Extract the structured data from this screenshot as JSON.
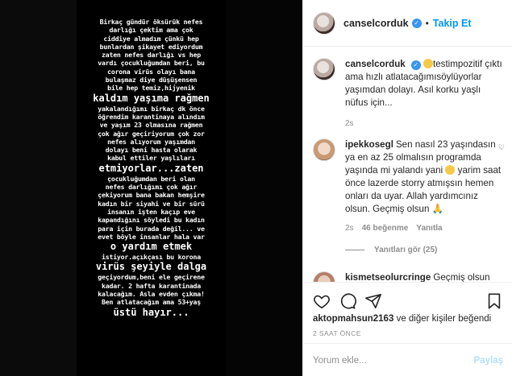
{
  "story": {
    "lines": [
      "Birkaç gündür öksürük nefes",
      "darlığı çektim ama çok",
      "ciddiye almadım çünkü hep",
      "bunlardan şikayet ediyordum",
      "zaten nefes darlığı vs hep",
      "vardı çocukluğumdan beri, bu",
      "corona virüs olayı bana",
      "bulaşmaz diye düşüşensen",
      "bile hep temiz,hijyenik",
      "kaldım yaşıma rağmen",
      "yakalandığımı birkaç dk önce",
      "öğrendim karantinaya alındım",
      "ve yaşım 23 olmasına rağmen",
      "çok ağır geçiriyorum çok zor",
      "nefes alıyorum yaşımdan",
      "dolayı beni hasta olarak",
      "kabul ettiler yaşlıları",
      "etmiyorlar...zaten",
      "çocukluğumdan beri olan",
      "nefes darlığımı çok ağır",
      "çekiyorum bana bakan hemşire",
      "kadın bir siyahi ve bir sürü",
      "insanın işten kaçıp eve",
      "kapandığını söyledi bu kadın",
      "para için burada değil... ve",
      "evet böyle insanlar hala var",
      "o yardım etmek",
      "istiyor.açıkçası bu korona",
      "virüs şeyiyle dalga",
      "geçiyordum,beni ele geçirene",
      "kadar. 2 hafta karantinada",
      "kalacağım. Asla evden çıkma!",
      "Ben atlatacağım ama 53+yaş",
      "üstü hayır..."
    ]
  },
  "header": {
    "username": "canselcorduk",
    "follow_label": "Takip Et",
    "dot": "•"
  },
  "caption": {
    "username": "canselcorduk",
    "text": "testimpozitif çıktı ama hızlı atlatacağımısöylüyorlar yaşımdan dolayı. Asıl korku yaşlı nüfus için...",
    "time": "2s"
  },
  "comment1": {
    "username": "ipekkosegl",
    "text_a": "Sen nasıl 23 yaşındasın ya en az 25 olmalısın programda yaşında mi yalandı yani",
    "text_b": "yarim saat önce lazerde storry atmışsın hemen onları da uyar. Allah yardımcınız olsun. Geçmiş olsun",
    "time": "2s",
    "likes": "46 beğenme",
    "reply": "Yanıtla",
    "view_replies": "Yanıtları gör (25)"
  },
  "comment2": {
    "username": "kismetseolurcringe",
    "text": "Geçmiş olsun"
  },
  "actions": {
    "liked_by": "aktopmahsun2163",
    "liked_rest": "ve diğer kişiler beğendi",
    "time": "2 SAAT ÖNCE"
  },
  "add_comment": {
    "placeholder": "Yorum ekle...",
    "share": "Paylaş"
  }
}
